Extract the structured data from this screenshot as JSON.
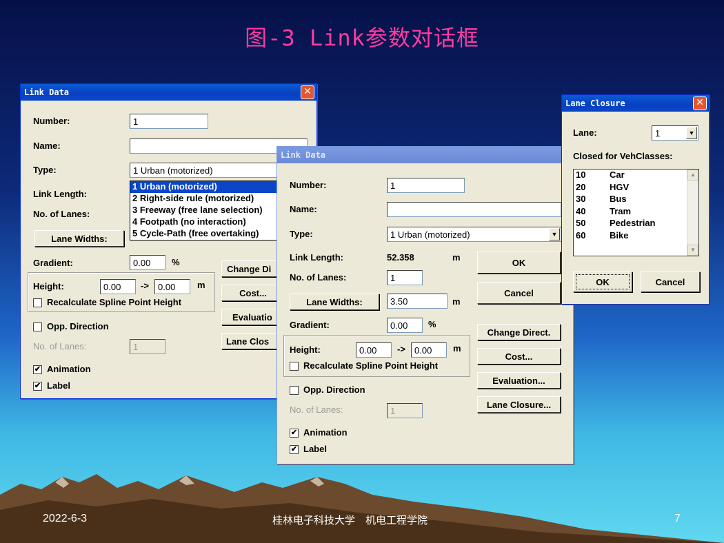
{
  "slide": {
    "title": "图-3 Link参数对话框",
    "date": "2022-6-3",
    "school": "桂林电子科技大学　机电工程学院",
    "page": "7"
  },
  "back_dialog": {
    "title": "Link Data",
    "close": "✕",
    "number_label": "Number:",
    "number_value": "1",
    "name_label": "Name:",
    "name_value": "",
    "type_label": "Type:",
    "type_value": "1 Urban (motorized)",
    "link_length_label": "Link Length:",
    "lanes_label": "No. of Lanes:",
    "lane_widths_button": "Lane Widths:",
    "gradient_label": "Gradient:",
    "gradient_value": "0.00",
    "gradient_unit": "%",
    "height_label": "Height:",
    "height_from": "0.00",
    "height_arrow": "->",
    "height_to": "0.00",
    "height_unit": "m",
    "recalc_label": "Recalculate Spline Point Height",
    "opp_direction_label": "Opp. Direction",
    "opp_lanes_label": "No. of Lanes:",
    "opp_lanes_value": "1",
    "animation_label": "Animation",
    "label_label": "Label",
    "change_direct_button": "Change Di",
    "cost_button": "Cost...",
    "evaluation_button": "Evaluatio",
    "lane_closure_button": "Lane Clos",
    "type_options": [
      "1 Urban (motorized)",
      "2 Right-side rule (motorized)",
      "3 Freeway (free lane selection)",
      "4 Footpath (no interaction)",
      "5 Cycle-Path (free overtaking)"
    ]
  },
  "front_dialog": {
    "title": "Link Data",
    "number_label": "Number:",
    "number_value": "1",
    "name_label": "Name:",
    "name_value": "",
    "type_label": "Type:",
    "type_value": "1 Urban (motorized)",
    "link_length_label": "Link Length:",
    "link_length_value": "52.358",
    "link_length_unit": "m",
    "lanes_label": "No. of Lanes:",
    "lanes_value": "1",
    "lane_widths_button": "Lane Widths:",
    "lane_widths_value": "3.50",
    "lane_widths_unit": "m",
    "gradient_label": "Gradient:",
    "gradient_value": "0.00",
    "gradient_unit": "%",
    "height_label": "Height:",
    "height_from": "0.00",
    "height_arrow": "->",
    "height_to": "0.00",
    "height_unit": "m",
    "recalc_label": "Recalculate Spline Point Height",
    "opp_direction_label": "Opp. Direction",
    "opp_lanes_label": "No. of Lanes:",
    "opp_lanes_value": "1",
    "animation_label": "Animation",
    "label_label": "Label",
    "ok_button": "OK",
    "cancel_button": "Cancel",
    "change_direct_button": "Change Direct.",
    "cost_button": "Cost...",
    "evaluation_button": "Evaluation...",
    "lane_closure_button": "Lane Closure..."
  },
  "lane_closure": {
    "title": "Lane Closure",
    "close": "✕",
    "lane_label": "Lane:",
    "lane_value": "1",
    "closed_label": "Closed for VehClasses:",
    "classes": [
      {
        "code": "10",
        "name": "Car"
      },
      {
        "code": "20",
        "name": "HGV"
      },
      {
        "code": "30",
        "name": "Bus"
      },
      {
        "code": "40",
        "name": "Tram"
      },
      {
        "code": "50",
        "name": "Pedestrian"
      },
      {
        "code": "60",
        "name": "Bike"
      }
    ],
    "ok_button": "OK",
    "cancel_button": "Cancel"
  }
}
